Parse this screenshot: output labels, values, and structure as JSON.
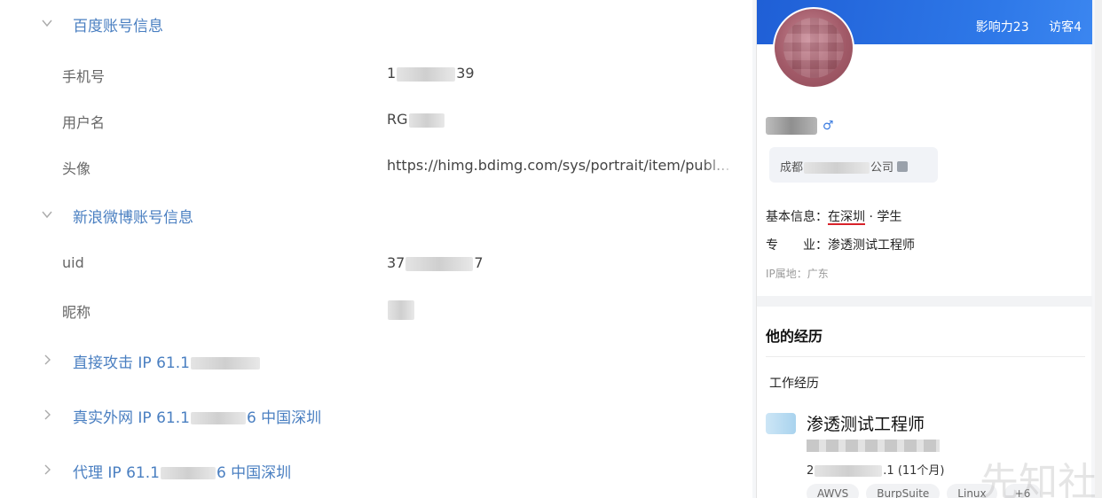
{
  "left": {
    "sections": {
      "baidu": {
        "label": "百度账号信息"
      },
      "weibo": {
        "label": "新浪微博账号信息"
      },
      "direct_ip": {
        "label_prefix": "直接攻击 IP 61.1"
      },
      "real_ip": {
        "label_prefix": "真实外网 IP 61.1",
        "label_suffix": "6 中国深圳"
      },
      "proxy_ip": {
        "label_prefix": "代理 IP 61.1",
        "label_suffix": "6 中国深圳"
      }
    },
    "baidu_rows": {
      "phone": {
        "label": "手机号",
        "value_prefix": "1",
        "value_suffix": "39"
      },
      "username": {
        "label": "用户名",
        "value_prefix": "RG"
      },
      "avatar": {
        "label": "头像",
        "value": "https://himg.bdimg.com/sys/portrait/item/publ..."
      }
    },
    "weibo_rows": {
      "uid": {
        "label": "uid",
        "value_prefix": "37",
        "value_suffix": "7"
      },
      "nickname": {
        "label": "昵称"
      }
    }
  },
  "right": {
    "stats": {
      "influence": "影响力23",
      "visitors": "访客4"
    },
    "gender_symbol": "♂",
    "company": {
      "prefix": "成都",
      "suffix": "公司"
    },
    "basic_info": {
      "label": "基本信息：",
      "location": "在深圳",
      "sep": " · ",
      "role": "学生"
    },
    "major": {
      "label": "专　　业：",
      "value": "渗透测试工程师"
    },
    "ip_location": "IP属地：广东",
    "experience_title": "他的经历",
    "work_title": "工作经历",
    "job": {
      "title": "渗透测试工程师",
      "dates_prefix": "2",
      "dates_suffix": ".1 (11个月)"
    },
    "tags": [
      "AWVS",
      "BurpSuite",
      "Linux",
      "+6"
    ],
    "watermark": "先知社"
  }
}
